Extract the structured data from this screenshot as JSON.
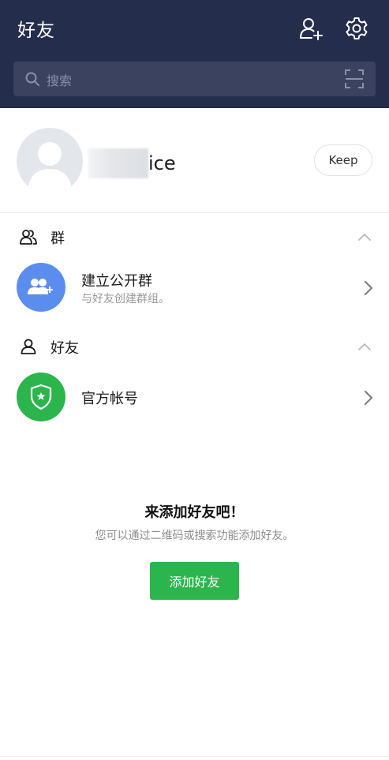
{
  "header": {
    "title": "好友",
    "add_friend_icon": "person-add-icon",
    "settings_icon": "gear-icon"
  },
  "search": {
    "placeholder": "搜索",
    "icon": "search-icon",
    "scan_icon": "qr-scan-icon"
  },
  "profile": {
    "name_visible_part": "ice",
    "keep_label": "Keep"
  },
  "groups_section": {
    "label": "群",
    "rows": [
      {
        "title": "建立公开群",
        "subtitle": "与好友创建群组。",
        "avatar_color": "#5b8def"
      }
    ]
  },
  "friends_section": {
    "label": "好友",
    "rows": [
      {
        "title": "官方帐号",
        "avatar_color": "#2bb54c"
      }
    ]
  },
  "empty_state": {
    "title": "来添加好友吧！",
    "subtitle": "您可以通过二维码或搜索功能添加好友。",
    "button_label": "添加好友"
  },
  "colors": {
    "header_bg": "#252d4d",
    "search_bg": "#3b4260",
    "accent_green": "#2bb54c",
    "accent_blue": "#5b8def"
  }
}
